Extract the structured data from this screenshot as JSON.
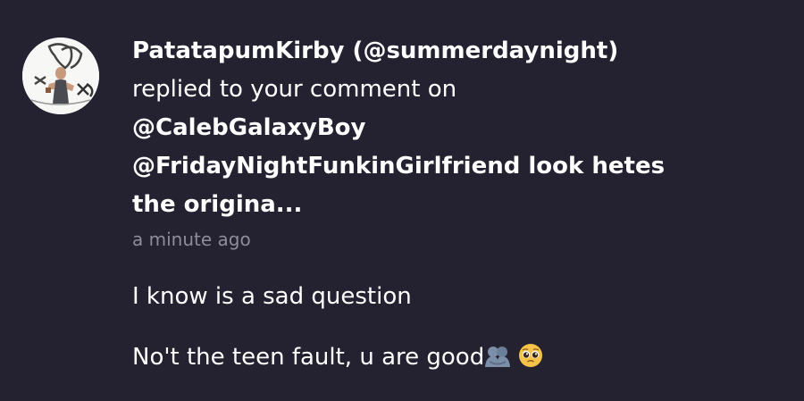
{
  "notification": {
    "avatar_icon": "user-avatar-icon",
    "sender": "PatatapumKirby (@summerdaynight)",
    "action": "replied to your comment on",
    "target_mention": "@CalebGalaxyBoy",
    "preview_line_1": "@FridayNightFunkinGirlfriend look hetes",
    "preview_line_2": "the origina...",
    "timestamp": "a minute ago",
    "messages": [
      "I know is a sad question",
      "No't the teen fault, u are good"
    ],
    "emojis": [
      "people-hugging-emoji",
      "pleading-face-emoji"
    ]
  },
  "colors": {
    "background": "#242230",
    "text": "#ffffff",
    "timestamp": "#8e8c99",
    "hug_emoji": "#7b8fa8",
    "pleading_emoji": "#f6c34a"
  }
}
